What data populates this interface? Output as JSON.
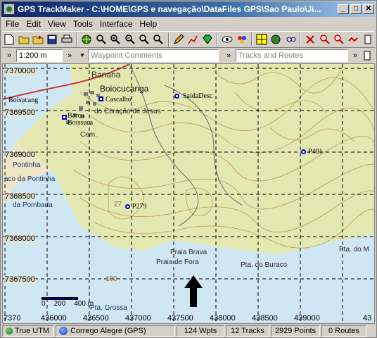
{
  "window": {
    "title": "GPS TrackMaker - C:\\HOME\\GPS e navegação\\DataFiles GPS\\Sao Paulo\\Ji...",
    "minimize_label": "_",
    "maximize_label": "□",
    "close_label": "✕"
  },
  "menu": [
    "File",
    "Edit",
    "View",
    "Tools",
    "Interface",
    "Help"
  ],
  "toolbar2": {
    "scale_value": "1:200 m",
    "waypoint_placeholder": "Waypoint Comments",
    "tracks_placeholder": "Tracks and Routes"
  },
  "map": {
    "y_coords": [
      "7370000",
      "7369500",
      "7369000",
      "7368500",
      "7368000",
      "7367500"
    ],
    "x_coords": [
      "436000",
      "436500",
      "437000",
      "437500",
      "438000",
      "438500",
      "439000",
      "43"
    ],
    "x_axis_start": "7370",
    "waypoints": [
      {
        "name": "Boisucang"
      },
      {
        "name": "Cascalho"
      },
      {
        "name": "SaidaDesc"
      },
      {
        "name": "Barco"
      },
      {
        "name": "Boissuca"
      },
      {
        "name": "P491"
      },
      {
        "name": "P279"
      }
    ],
    "places": [
      "Banana",
      "Boiocucanga",
      "do Coração de Jesus",
      "Cem.",
      "Pontinha",
      "aco da Pontinha",
      "da Pombada",
      "Praia Brava",
      "Praia de Fora",
      "Pta. do Buraco",
      "Pta. do M",
      "Pta. Grossa",
      "27",
      "100"
    ],
    "scale": {
      "labels": [
        "0",
        "200",
        "400 m"
      ]
    }
  },
  "status": {
    "coord_system": "True UTM",
    "datum": "Corrego Alegre (GPS)",
    "waypoints": "124 Wpts",
    "tracks": "12 Tracks",
    "points": "2929 Points",
    "routes": "0 Routes"
  }
}
